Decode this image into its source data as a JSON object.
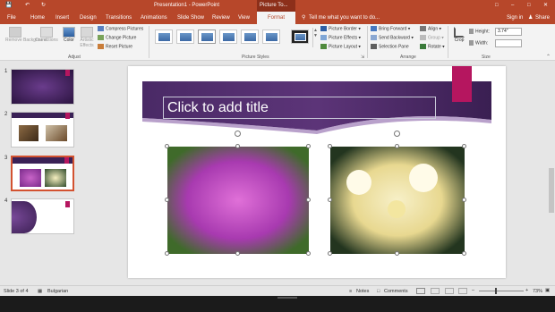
{
  "titlebar": {
    "title": "Presentation1 - PowerPoint",
    "context_tab": "Picture To...",
    "minimize_icon": "minimize-icon",
    "restore_icon": "restore-icon",
    "close_icon": "close-icon"
  },
  "tabs": [
    "File",
    "Home",
    "Insert",
    "Design",
    "Transitions",
    "Animations",
    "Slide Show",
    "Review",
    "View",
    "Format"
  ],
  "active_tab": "Format",
  "tell_me": "Tell me what you want to do...",
  "sign_in": "Sign in",
  "share": "Share",
  "ribbon": {
    "adjust": {
      "remove_background": "Remove Background",
      "corrections": "Corrections",
      "color": "Color",
      "artistic_effects": "Artistic Effects",
      "compress_pictures": "Compress Pictures",
      "change_picture": "Change Picture",
      "reset_picture": "Reset Picture",
      "group_label": "Adjust"
    },
    "picture_styles": {
      "group_label": "Picture Styles",
      "picture_border": "Picture Border",
      "picture_effects": "Picture Effects",
      "picture_layout": "Picture Layout"
    },
    "arrange": {
      "group_label": "Arrange",
      "bring_forward": "Bring Forward",
      "send_backward": "Send Backward",
      "selection_pane": "Selection Pane",
      "align": "Align",
      "group": "Group",
      "rotate": "Rotate"
    },
    "size": {
      "group_label": "Size",
      "crop": "Crop",
      "height_label": "Height:",
      "height_value": "3.74\"",
      "width_label": "Width:",
      "width_value": ""
    }
  },
  "slides": [
    "1",
    "2",
    "3",
    "4"
  ],
  "slide_canvas": {
    "title_placeholder": "Click to add title"
  },
  "status": {
    "slide_info": "Slide 3 of 4",
    "language": "Bulgarian",
    "notes": "Notes",
    "comments": "Comments",
    "zoom": "73%"
  },
  "colors": {
    "accent": "#b7472a",
    "banner": "#4a2a66",
    "magenta": "#b5165f"
  }
}
